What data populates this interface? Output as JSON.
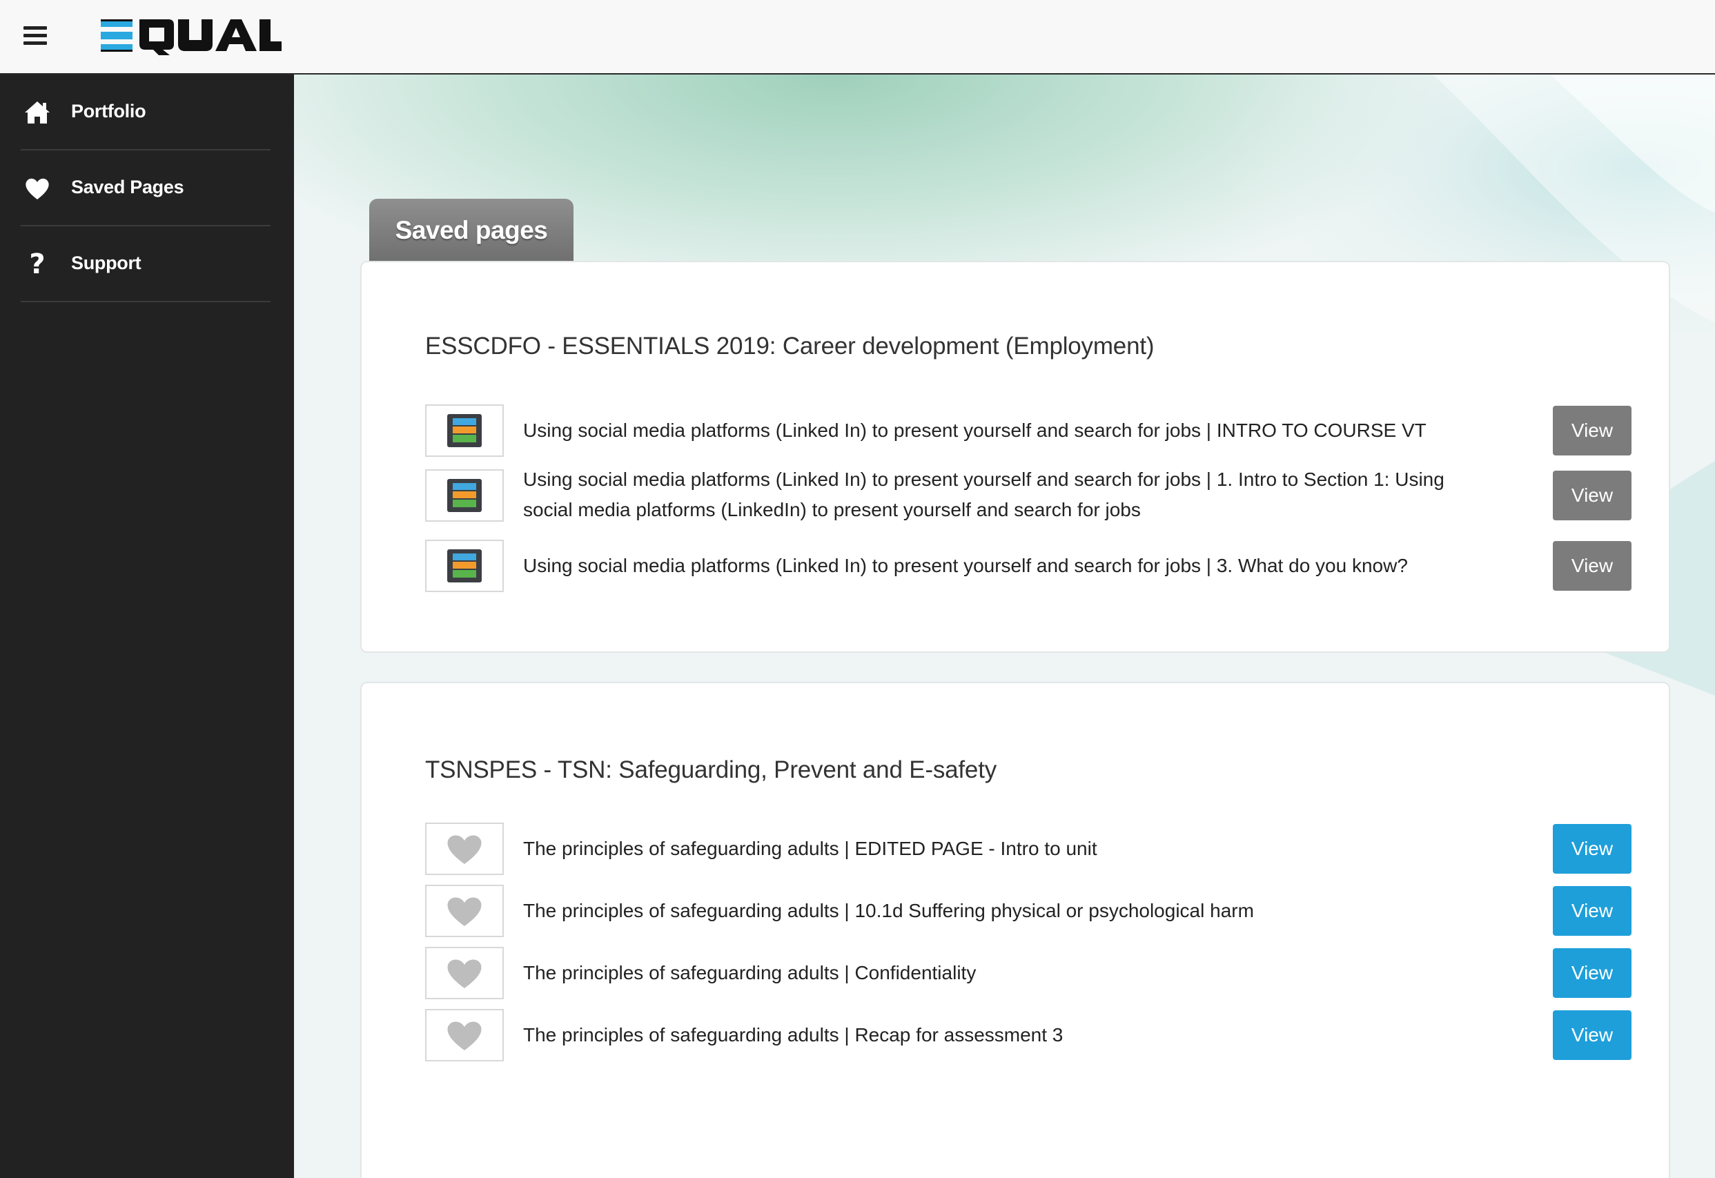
{
  "header": {
    "logo_text": "EQUAL",
    "menu_icon": "hamburger-menu-icon"
  },
  "sidebar": {
    "items": [
      {
        "label": "Portfolio",
        "icon": "home-icon"
      },
      {
        "label": "Saved Pages",
        "icon": "heart-icon"
      },
      {
        "label": "Support",
        "icon": "question-icon",
        "glyph": "?"
      }
    ]
  },
  "main": {
    "tab_label": "Saved pages",
    "groups": [
      {
        "title": "ESSCDFO - ESSENTIALS 2019: Career development (Employment)",
        "thumb_icon": "page-thumbnail-icon",
        "button_color": "#7c7c7c",
        "items": [
          {
            "text": "Using social media platforms (Linked In) to present yourself and search for jobs | INTRO TO COURSE VT",
            "button": "View"
          },
          {
            "text": "Using social media platforms (Linked In) to present yourself and search for jobs | 1. Intro to Section 1: Using social media platforms (LinkedIn) to present yourself and search for jobs",
            "button": "View"
          },
          {
            "text": "Using social media platforms (Linked In) to present yourself and search for jobs | 3. What do you know?",
            "button": "View"
          }
        ]
      },
      {
        "title": "TSNSPES - TSN: Safeguarding, Prevent and E-safety",
        "thumb_icon": "heart-icon",
        "button_color": "#1e9fda",
        "items": [
          {
            "text": "The principles of safeguarding adults | EDITED PAGE - Intro to unit",
            "button": "View"
          },
          {
            "text": "The principles of safeguarding adults | 10.1d Suffering physical or psychological harm",
            "button": "View"
          },
          {
            "text": "The principles of safeguarding adults | Confidentiality",
            "button": "View"
          },
          {
            "text": "The principles of safeguarding adults | Recap for assessment 3",
            "button": "View"
          }
        ]
      }
    ]
  },
  "colors": {
    "sidebar_bg": "#222222",
    "accent_blue": "#1e9fda",
    "button_grey": "#7c7c7c",
    "logo_blue": "#29a9e0"
  }
}
